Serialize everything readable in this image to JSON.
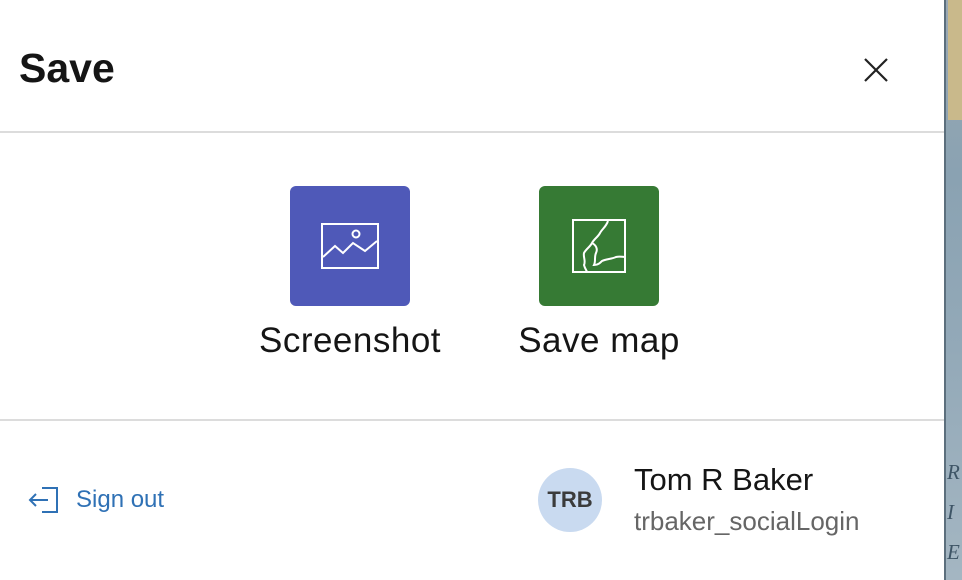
{
  "header": {
    "title": "Save",
    "close_icon": "close-icon"
  },
  "actions": [
    {
      "label": "Screenshot",
      "icon": "image-icon",
      "color": "#4f59b8"
    },
    {
      "label": "Save map",
      "icon": "map-icon",
      "color": "#367a34"
    }
  ],
  "footer": {
    "sign_out_label": "Sign out",
    "sign_out_icon": "sign-out-icon",
    "user": {
      "initials": "TRB",
      "name": "Tom R Baker",
      "username": "trbaker_socialLogin"
    }
  },
  "map_edge_letters": [
    "R",
    "I",
    "E"
  ],
  "colors": {
    "link": "#2f71b5",
    "avatar_bg": "#c9daf0",
    "divider": "#dcdcdc"
  }
}
